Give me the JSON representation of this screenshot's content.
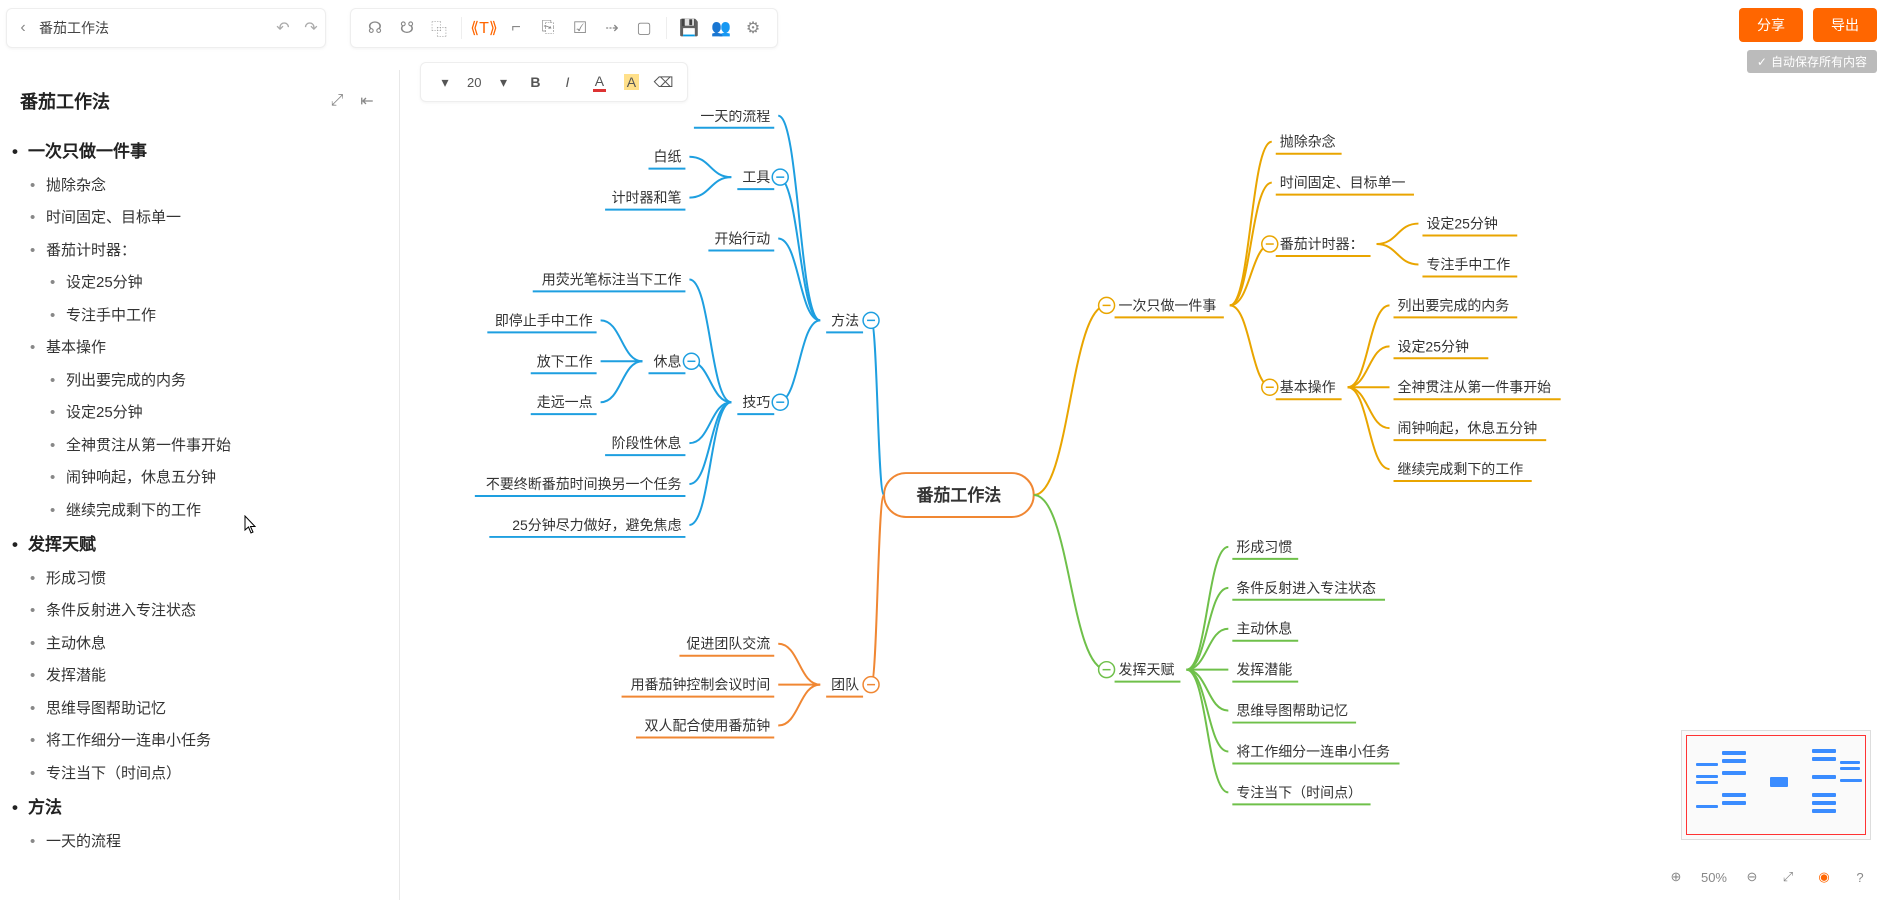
{
  "app": {
    "title": "番茄工作法",
    "autosave": "自动保存所有内容"
  },
  "header_buttons": {
    "share": "分享",
    "export": "导出"
  },
  "format_bar": {
    "font_size": "20",
    "dropdown_marker": "▾"
  },
  "sidebar": {
    "title": "番茄工作法",
    "items": [
      {
        "lvl": "h1",
        "t": "一次只做一件事"
      },
      {
        "lvl": "h2",
        "t": "抛除杂念"
      },
      {
        "lvl": "h2",
        "t": "时间固定、目标单一"
      },
      {
        "lvl": "h2",
        "t": "番茄计时器："
      },
      {
        "lvl": "h3",
        "t": "设定25分钟"
      },
      {
        "lvl": "h3",
        "t": "专注手中工作"
      },
      {
        "lvl": "h2",
        "t": "基本操作"
      },
      {
        "lvl": "h3",
        "t": "列出要完成的内务"
      },
      {
        "lvl": "h3",
        "t": "设定25分钟"
      },
      {
        "lvl": "h3",
        "t": "全神贯注从第一件事开始"
      },
      {
        "lvl": "h3",
        "t": "闹钟响起，休息五分钟"
      },
      {
        "lvl": "h3",
        "t": "继续完成剩下的工作"
      },
      {
        "lvl": "h1",
        "t": "发挥天赋"
      },
      {
        "lvl": "h2",
        "t": "形成习惯"
      },
      {
        "lvl": "h2",
        "t": "条件反射进入专注状态"
      },
      {
        "lvl": "h2",
        "t": "主动休息"
      },
      {
        "lvl": "h2",
        "t": "发挥潜能"
      },
      {
        "lvl": "h2",
        "t": "思维导图帮助记忆"
      },
      {
        "lvl": "h2",
        "t": "将工作细分一连串小任务"
      },
      {
        "lvl": "h2",
        "t": "专注当下（时间点）"
      },
      {
        "lvl": "h1",
        "t": "方法"
      },
      {
        "lvl": "h2",
        "t": "一天的流程"
      }
    ]
  },
  "zoom": {
    "percent": "50%"
  },
  "mindmap": {
    "root": "番茄工作法",
    "right": [
      {
        "label": "一次只做一件事",
        "color": "#e9a500",
        "children": [
          {
            "label": "抛除杂念"
          },
          {
            "label": "时间固定、目标单一"
          },
          {
            "label": "番茄计时器：",
            "children": [
              {
                "label": "设定25分钟"
              },
              {
                "label": "专注手中工作"
              }
            ]
          },
          {
            "label": "基本操作",
            "children": [
              {
                "label": "列出要完成的内务"
              },
              {
                "label": "设定25分钟"
              },
              {
                "label": "全神贯注从第一件事开始"
              },
              {
                "label": "闹钟响起，休息五分钟"
              },
              {
                "label": "继续完成剩下的工作"
              }
            ]
          }
        ]
      },
      {
        "label": "发挥天赋",
        "color": "#6fc04a",
        "children": [
          {
            "label": "形成习惯"
          },
          {
            "label": "条件反射进入专注状态"
          },
          {
            "label": "主动休息"
          },
          {
            "label": "发挥潜能"
          },
          {
            "label": "思维导图帮助记忆"
          },
          {
            "label": "将工作细分一连串小任务"
          },
          {
            "label": "专注当下（时间点）"
          }
        ]
      }
    ],
    "left": [
      {
        "label": "方法",
        "color": "#1e9fe0",
        "children": [
          {
            "label": "一天的流程"
          },
          {
            "label": "工具",
            "children": [
              {
                "label": "白纸"
              },
              {
                "label": "计时器和笔"
              }
            ]
          },
          {
            "label": "开始行动"
          },
          {
            "label": "技巧",
            "children": [
              {
                "label": "用荧光笔标注当下工作"
              },
              {
                "label": "休息",
                "children": [
                  {
                    "label": "即停止手中工作"
                  },
                  {
                    "label": "放下工作"
                  },
                  {
                    "label": "走远一点"
                  }
                ]
              },
              {
                "label": "阶段性休息"
              },
              {
                "label": "不要终断番茄时间换另一个任务"
              },
              {
                "label": "25分钟尽力做好，避免焦虑"
              }
            ]
          }
        ]
      },
      {
        "label": "团队",
        "color": "#f08733",
        "children": [
          {
            "label": "促进团队交流"
          },
          {
            "label": "用番茄钟控制会议时间"
          },
          {
            "label": "双人配合使用番茄钟"
          }
        ]
      }
    ]
  }
}
